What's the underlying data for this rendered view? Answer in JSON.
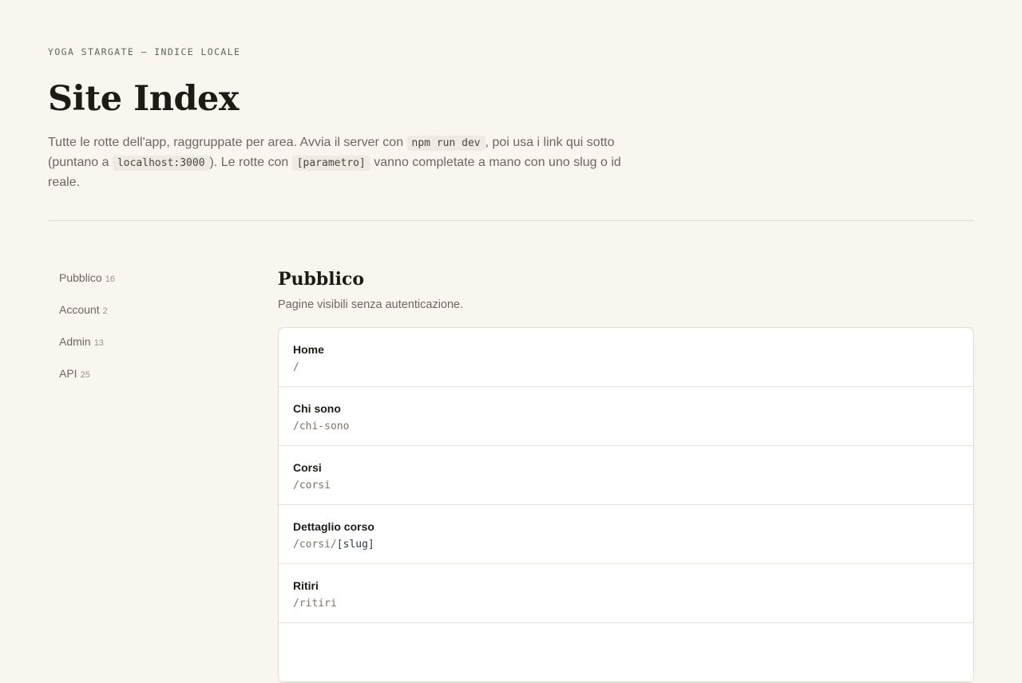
{
  "header": {
    "eyebrow": "YOGA STARGATE — INDICE LOCALE",
    "title": "Site Index",
    "intro": {
      "part1": "Tutte le rotte dell'app, raggruppate per area. Avvia il server con ",
      "code1": "npm run dev",
      "part2": ", poi usa i link qui sotto (puntano a ",
      "code2": "localhost:3000",
      "part3": "). Le rotte con ",
      "code3": "[parametro]",
      "part4": " vanno completate a mano con uno slug o id reale."
    }
  },
  "sidebar": {
    "items": [
      {
        "label": "Pubblico",
        "count": "16"
      },
      {
        "label": "Account",
        "count": "2"
      },
      {
        "label": "Admin",
        "count": "13"
      },
      {
        "label": "API",
        "count": "25"
      }
    ]
  },
  "section": {
    "title": "Pubblico",
    "description": "Pagine visibili senza autenticazione.",
    "routes": [
      {
        "name": "Home",
        "path": "/",
        "param": ""
      },
      {
        "name": "Chi sono",
        "path": "/chi-sono",
        "param": ""
      },
      {
        "name": "Corsi",
        "path": "/corsi",
        "param": ""
      },
      {
        "name": "Dettaglio corso",
        "path": "/corsi/",
        "param": "[slug]"
      },
      {
        "name": "Ritiri",
        "path": "/ritiri",
        "param": ""
      }
    ]
  },
  "colors": {
    "background": "#f9f6f0",
    "card": "#ffffff",
    "heading": "#1e1b17",
    "eyebrow": "#5b6a57",
    "border": "#e3ddd2"
  }
}
